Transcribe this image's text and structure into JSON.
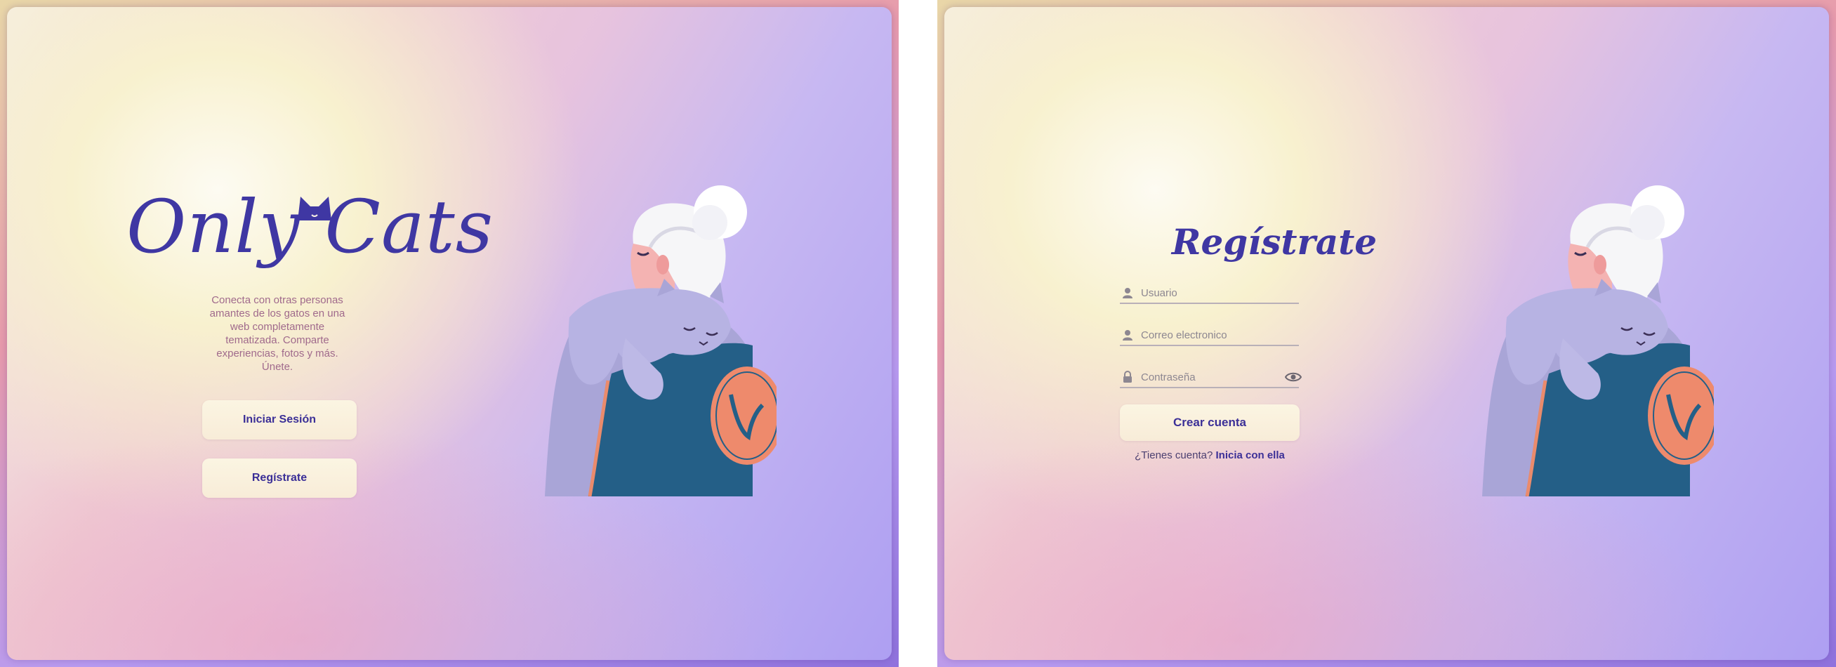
{
  "left_screen": {
    "brand": "Only Cats",
    "tagline": "Conecta con otras personas amantes de los gatos en una web completamente tematizada. Comparte experiencias, fotos y más. Únete.",
    "login_button": "Iniciar Sesión",
    "register_button": "Regístrate"
  },
  "right_screen": {
    "title": "Regístrate",
    "fields": {
      "username_placeholder": "Usuario",
      "email_placeholder": "Correo electronico",
      "password_placeholder": "Contraseña"
    },
    "create_button": "Crear cuenta",
    "have_account_text": "¿Tienes cuenta?",
    "login_link": "Inicia con ella"
  },
  "icons": {
    "user": "user-icon",
    "lock": "lock-icon",
    "eye": "eye-icon"
  },
  "colors": {
    "brand": "#3f37a3",
    "tagline": "#a06a8c",
    "button_bg": "#fbf5e2",
    "button_text": "#3b2f97"
  }
}
